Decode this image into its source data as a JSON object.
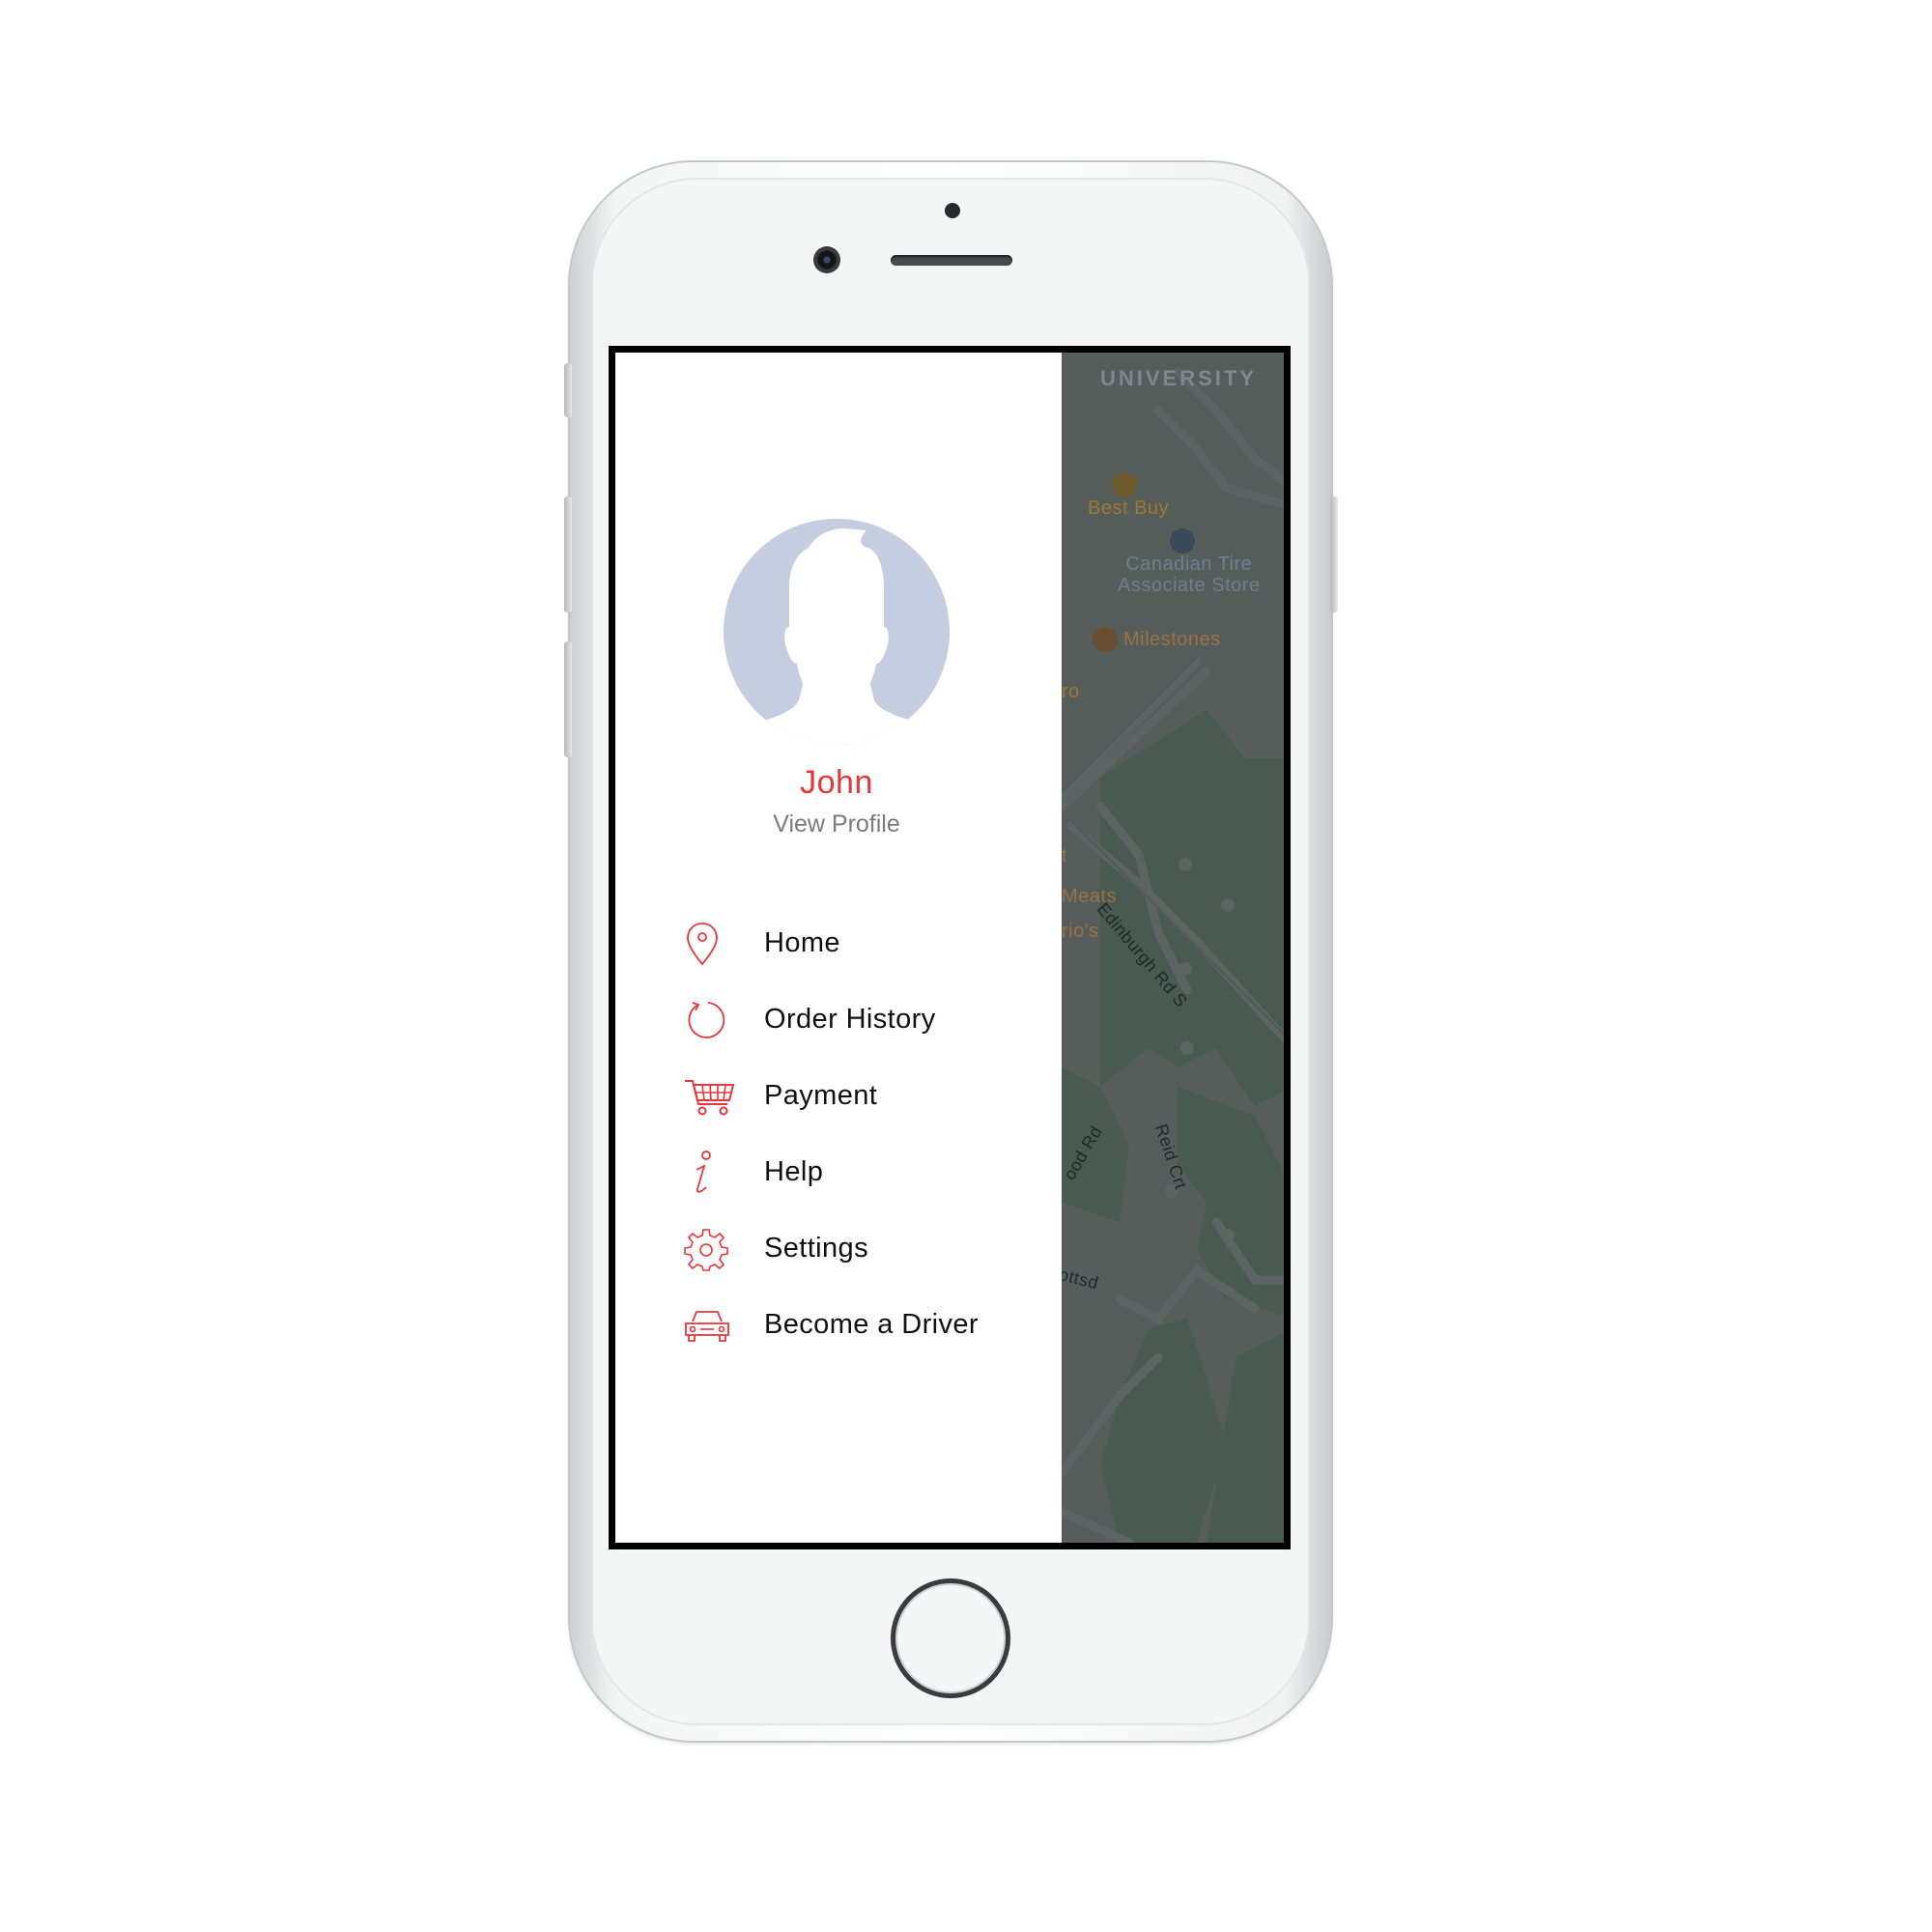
{
  "profile": {
    "name": "John",
    "view_profile_label": "View Profile"
  },
  "menu": {
    "items": [
      {
        "label": "Home",
        "icon": "map-pin-icon"
      },
      {
        "label": "Order History",
        "icon": "history-icon"
      },
      {
        "label": "Payment",
        "icon": "shopping-cart-icon"
      },
      {
        "label": "Help",
        "icon": "info-icon"
      },
      {
        "label": "Settings",
        "icon": "gear-icon"
      },
      {
        "label": "Become a Driver",
        "icon": "car-icon"
      }
    ]
  },
  "map": {
    "area_label": "UNIVERSITY",
    "pois": [
      {
        "name": "Best Buy"
      },
      {
        "name": "Canadian Tire",
        "name_line2": "Associate Store"
      },
      {
        "name": "Milestones"
      },
      {
        "name": "ro"
      },
      {
        "name": "t"
      },
      {
        "name": "Meats"
      },
      {
        "name": "rio's"
      }
    ],
    "streets": [
      {
        "name": "Edinburgh Rd S"
      },
      {
        "name": "Reid Crt"
      },
      {
        "name": "ood Rd"
      },
      {
        "name": "ottsd"
      }
    ]
  },
  "colors": {
    "accent": "#e8363a",
    "avatar_bg": "#c5cee0",
    "map_overlay": "#3c4747"
  }
}
